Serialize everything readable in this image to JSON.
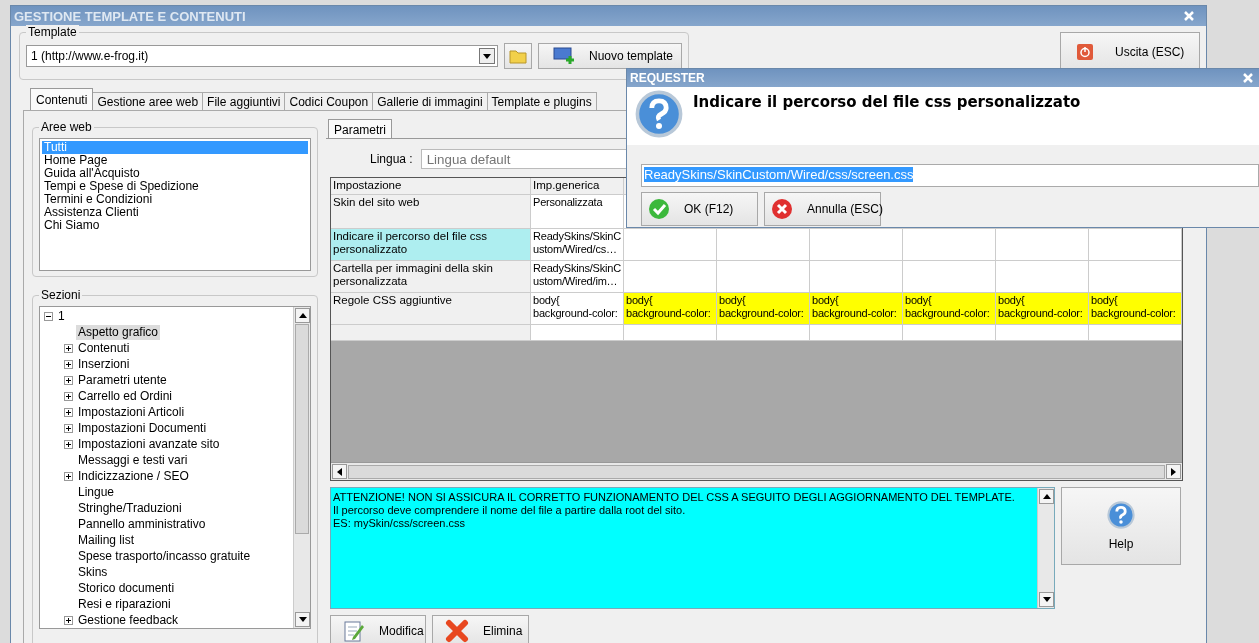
{
  "window": {
    "title": "GESTIONE TEMPLATE E CONTENUTI"
  },
  "template": {
    "label": "Template",
    "value": "1 (http://www.e-frog.it)",
    "new_button": "Nuovo template"
  },
  "exit_button": "Uscita (ESC)",
  "tabs": [
    {
      "label": "Contenuti",
      "selected": true
    },
    {
      "label": "Gestione aree web",
      "selected": false
    },
    {
      "label": "File aggiuntivi",
      "selected": false
    },
    {
      "label": "Codici Coupon",
      "selected": false
    },
    {
      "label": "Gallerie di immagini",
      "selected": false
    },
    {
      "label": "Template e plugins",
      "selected": false
    }
  ],
  "web_areas": {
    "label": "Aree web",
    "items": [
      {
        "label": "Tutti",
        "selected": true
      },
      {
        "label": "Home Page",
        "selected": false
      },
      {
        "label": "Guida all'Acquisto",
        "selected": false
      },
      {
        "label": "Tempi e Spese di Spedizione",
        "selected": false
      },
      {
        "label": "Termini e Condizioni",
        "selected": false
      },
      {
        "label": "Assistenza Clienti",
        "selected": false
      },
      {
        "label": "Chi Siamo",
        "selected": false
      }
    ]
  },
  "sections": {
    "label": "Sezioni",
    "tree": [
      {
        "label": "1",
        "expanded": true,
        "selected": false,
        "children": [
          {
            "label": "Aspetto grafico",
            "selected": true
          },
          {
            "label": "Contenuti",
            "expanded": false,
            "selected": false
          },
          {
            "label": "Inserzioni",
            "expanded": false,
            "selected": false
          },
          {
            "label": "Parametri utente",
            "expanded": false,
            "selected": false
          },
          {
            "label": "Carrello ed Ordini",
            "expanded": false,
            "selected": false
          },
          {
            "label": "Impostazioni Articoli",
            "expanded": false,
            "selected": false
          },
          {
            "label": "Impostazioni Documenti",
            "expanded": false,
            "selected": false
          },
          {
            "label": "Impostazioni avanzate sito",
            "expanded": false,
            "selected": false
          },
          {
            "label": "Messaggi e testi vari",
            "selected": false
          },
          {
            "label": "Indicizzazione / SEO",
            "expanded": false,
            "selected": false
          },
          {
            "label": "Lingue",
            "selected": false
          },
          {
            "label": "Stringhe/Traduzioni",
            "selected": false
          },
          {
            "label": "Pannello amministrativo",
            "selected": false
          },
          {
            "label": "Mailing list",
            "selected": false
          },
          {
            "label": "Spese trasporto/incasso gratuite",
            "selected": false
          },
          {
            "label": "Skins",
            "selected": false
          },
          {
            "label": "Storico documenti",
            "selected": false
          },
          {
            "label": "Resi e riparazioni",
            "selected": false
          },
          {
            "label": "Gestione feedback",
            "expanded": false,
            "selected": false
          }
        ]
      }
    ]
  },
  "parameters": {
    "tab": {
      "label": "Parametri",
      "selected": true
    },
    "language_label": "Lingua :",
    "language_placeholder": "Lingua default",
    "columns": [
      "Impostazione",
      "Imp.generica"
    ],
    "rows": [
      {
        "setting": "Skin del sito web",
        "generic": "Personalizzata",
        "selected": false
      },
      {
        "setting": "Indicare il percorso del file css personalizzato",
        "generic": "ReadySkins/SkinCustom/Wired/cs…",
        "selected": true
      },
      {
        "setting": "Cartella per immagini della skin personalizzata",
        "generic": "ReadySkins/SkinCustom/Wired/im…",
        "selected": false
      },
      {
        "setting": "Regole CSS aggiuntive",
        "generic": "body{ background-color:",
        "selected": false,
        "overrides": [
          "body{ background-color:",
          "body{ background-color:",
          "body{ background-color:",
          "body{ background-color:",
          "body{ background-color:",
          "body{ background-color:"
        ]
      }
    ]
  },
  "info": {
    "lines": [
      "ATTENZIONE! NON SI ASSICURA IL CORRETTO FUNZIONAMENTO DEL CSS A SEGUITO DEGLI AGGIORNAMENTO DEL TEMPLATE.",
      "Il percorso deve comprendere il nome del file a partire dalla root del sito.",
      "ES: mySkin/css/screen.css"
    ]
  },
  "help_button": "Help",
  "actions": [
    "Modifica",
    "Elimina"
  ],
  "requester": {
    "title": "REQUESTER",
    "message": "Indicare il percorso del file css personalizzato",
    "value": "ReadySkins/SkinCustom/Wired/css/screen.css",
    "value_selected": true,
    "buttons": [
      "OK (F12)",
      "Annulla (ESC)"
    ]
  }
}
